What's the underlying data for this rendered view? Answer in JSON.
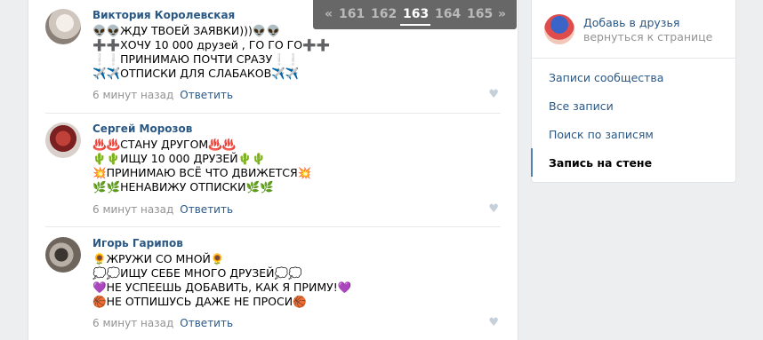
{
  "pagination": {
    "prev": "«",
    "pages": [
      "161",
      "162",
      "163",
      "164",
      "165"
    ],
    "current": "163",
    "next": "»"
  },
  "comments": [
    {
      "author": "Виктория Королевская",
      "lines": [
        "👽👽ЖДУ ТВОЕЙ ЗАЯВКИ)))👽👽",
        "➕➕ХОЧУ 10 000 друзей , ГО ГО ГО➕➕",
        "❕❕ПРИНИМАЮ ПОЧТИ СРАЗУ❕❕",
        "✈️✈️ОТПИСКИ ДЛЯ СЛАБАКОВ✈️✈️"
      ],
      "time": "6 минут назад",
      "reply": "Ответить"
    },
    {
      "author": "Сергей Морозов",
      "lines": [
        "♨️♨️СТАНУ ДРУГОМ♨️♨️",
        "🌵🌵ИЩУ 10 000 ДРУЗЕЙ🌵🌵",
        "💥ПРИНИМАЮ ВСЁ ЧТО ДВИЖЕТСЯ💥",
        "🌿🌿НЕНАВИЖУ ОТПИСКИ🌿🌿"
      ],
      "time": "6 минут назад",
      "reply": "Ответить"
    },
    {
      "author": "Игорь Гарипов",
      "lines": [
        "🌻ЖРУЖИ СО МНОЙ🌻",
        "💭💭ИЩУ СЕБЕ МНОГО ДРУЗЕЙ💭💭",
        "💜НЕ УСПЕЕШЬ ДОБАВИТЬ, КАК Я ПРИМУ!💜",
        "🏀НЕ ОТПИШУСЬ ДАЖЕ НЕ ПРОСИ🏀"
      ],
      "time": "6 минут назад",
      "reply": "Ответить"
    }
  ],
  "sidebar": {
    "friend_title": "Добавь в друзья",
    "friend_sub": "вернуться к странице",
    "menu": [
      "Записи сообщества",
      "Все записи",
      "Поиск по записям",
      "Запись на стене"
    ],
    "active_index": 3
  },
  "colors": {
    "link": "#2a5885",
    "muted": "#939393",
    "background": "#edeef0",
    "accent": "#5181b8"
  },
  "icons": {
    "like": "heart-icon"
  }
}
